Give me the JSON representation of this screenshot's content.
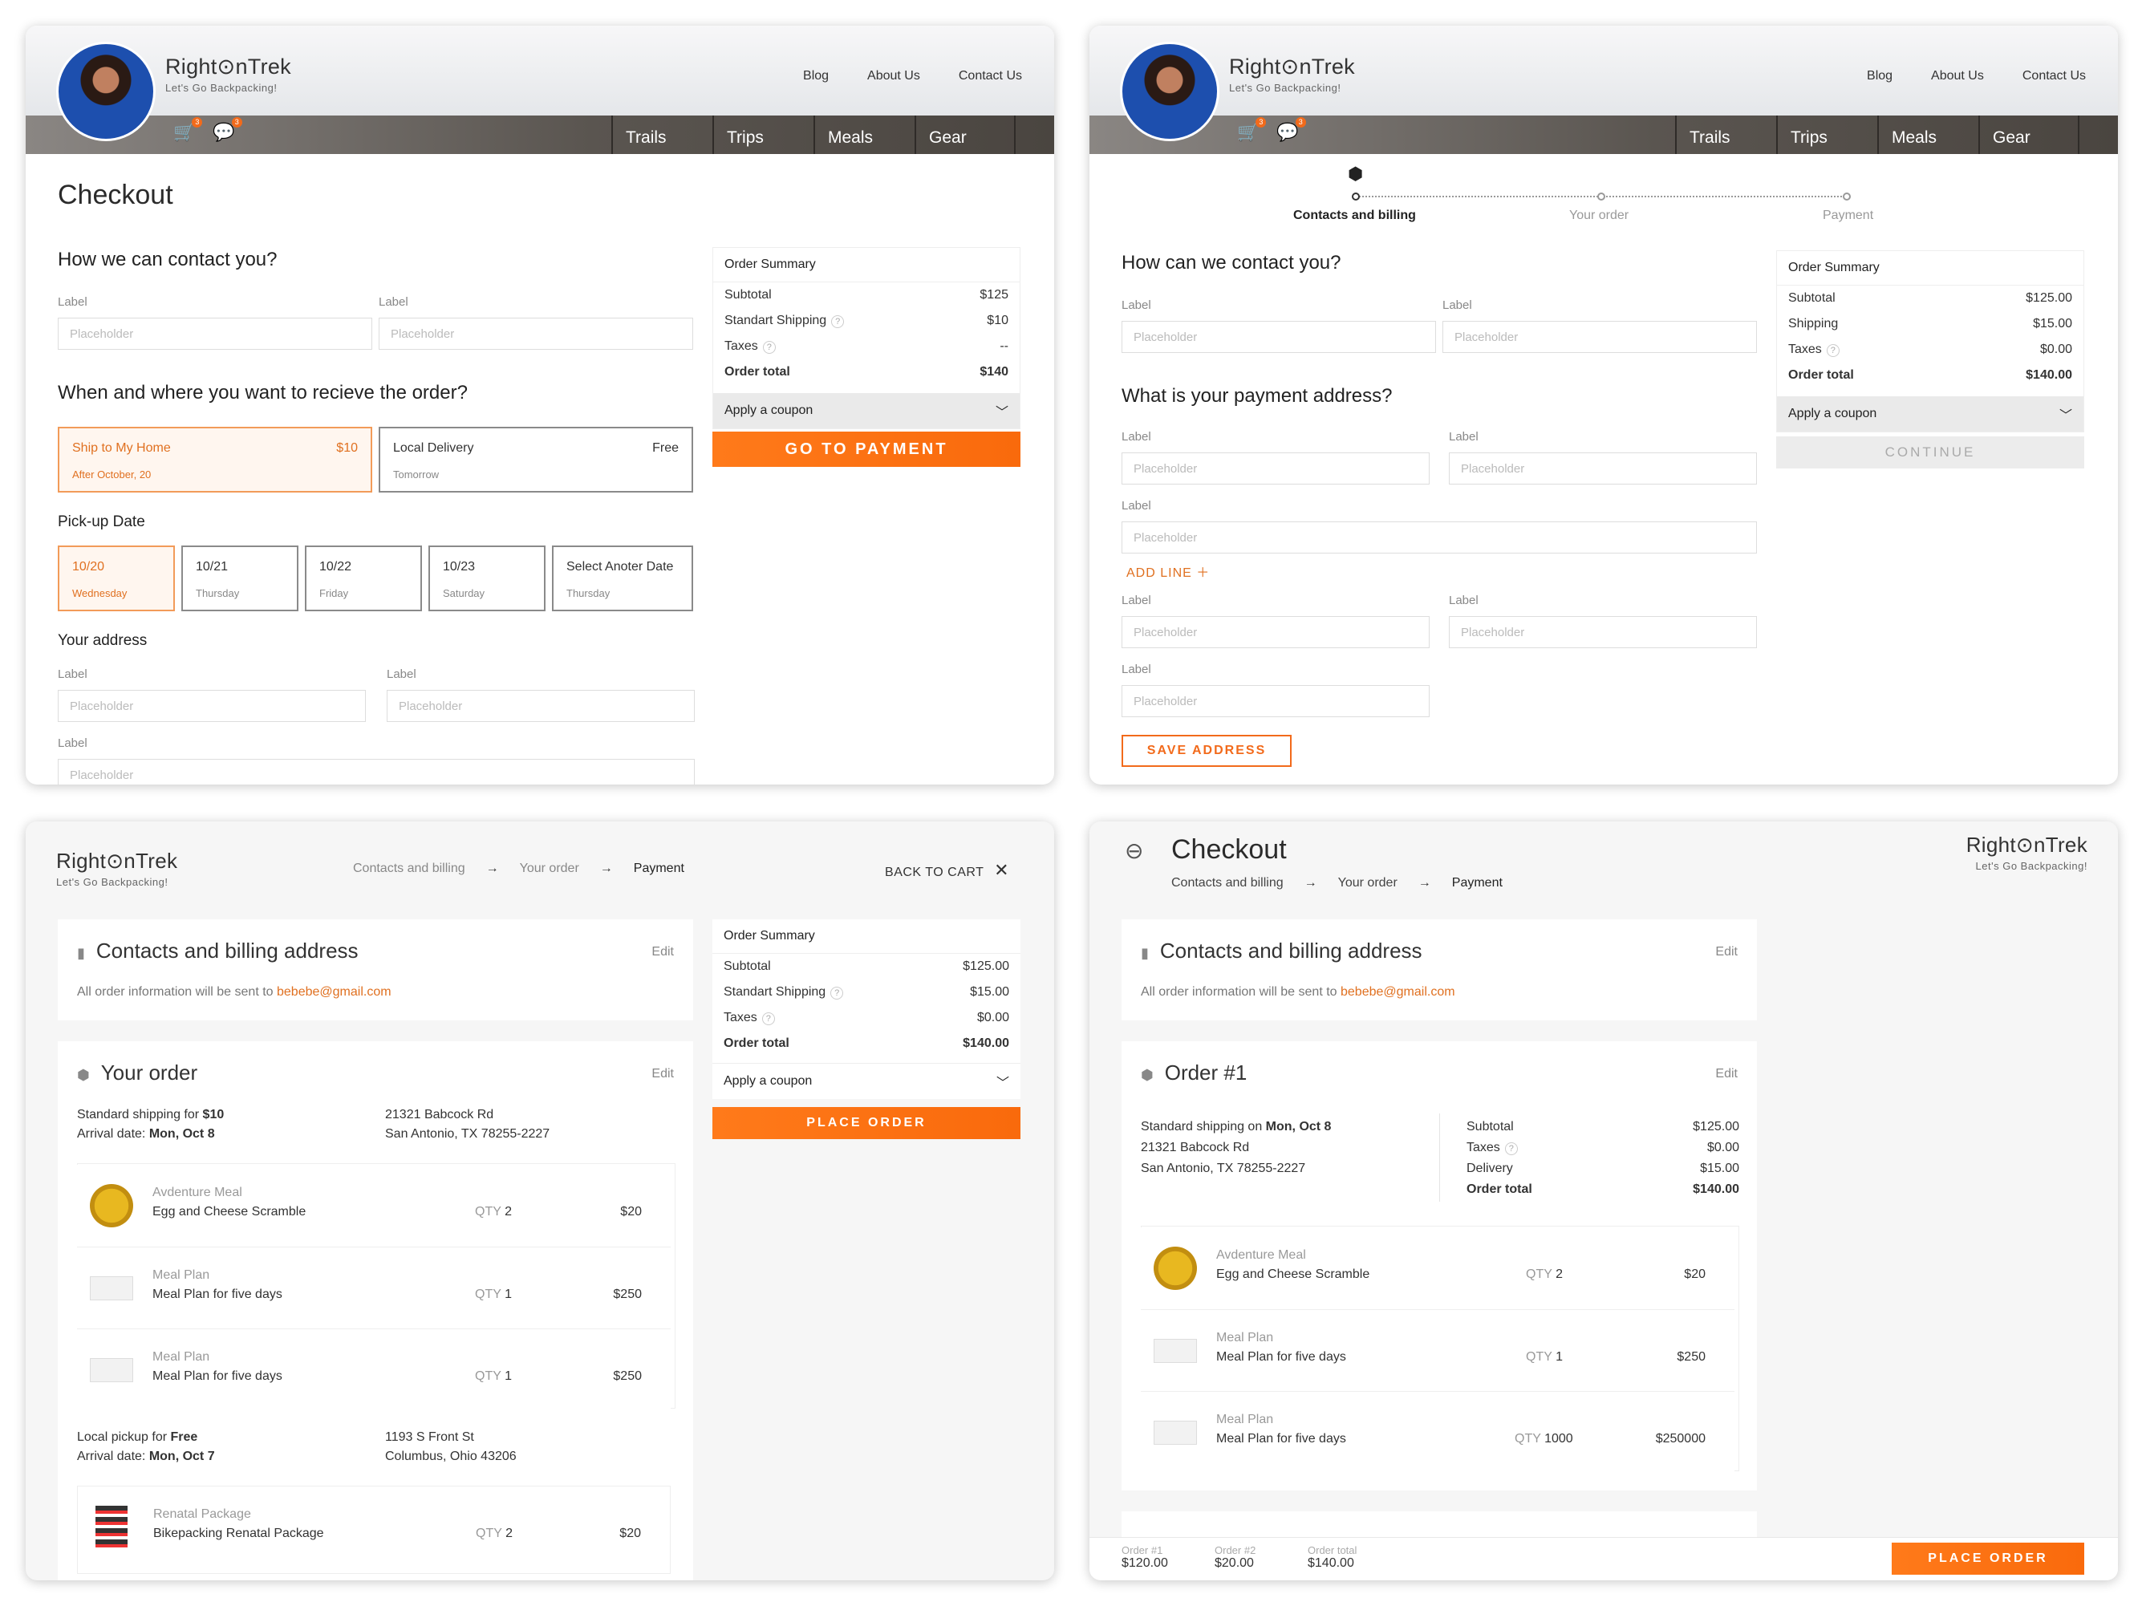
{
  "brand": {
    "name_a": "Right",
    "name_b": "nTrek",
    "tagline": "Let's Go Backpacking!"
  },
  "nav": {
    "links": [
      "Blog",
      "About Us",
      "Contact Us"
    ],
    "tabs": [
      "Trails",
      "Trips",
      "Meals",
      "Gear"
    ],
    "cart_count": "3",
    "msg_count": "3"
  },
  "s1": {
    "title": "Checkout",
    "contact_heading": "How we can contact you?",
    "label": "Label",
    "placeholder": "Placeholder",
    "delivery_heading": "When and where you want to recieve the order?",
    "ship_home": {
      "title": "Ship to My Home",
      "price": "$10",
      "sub": "After October, 20"
    },
    "local": {
      "title": "Local Delivery",
      "price": "Free",
      "sub": "Tomorrow"
    },
    "pickup_heading": "Pick-up Date",
    "dates": [
      {
        "d": "10/20",
        "w": "Wednesday"
      },
      {
        "d": "10/21",
        "w": "Thursday"
      },
      {
        "d": "10/22",
        "w": "Friday"
      },
      {
        "d": "10/23",
        "w": "Saturday"
      },
      {
        "d": "Select Anoter Date",
        "w": "Thursday"
      }
    ],
    "address_heading": "Your address",
    "summary": {
      "title": "Order Summary",
      "rows": [
        [
          "Subtotal",
          "$125"
        ],
        [
          "Standart Shipping",
          "$10"
        ],
        [
          "Taxes",
          "--"
        ],
        [
          "Order total",
          "$140"
        ]
      ],
      "coupon": "Apply a coupon",
      "button": "GO TO PAYMENT"
    }
  },
  "s2": {
    "steps": [
      "Contacts and billing",
      "Your order",
      "Payment"
    ],
    "contact_heading": "How can we contact you?",
    "payment_heading": "What is your payment address?",
    "add_line": "ADD LINE",
    "save": "SAVE ADDRESS",
    "summary": {
      "title": "Order Summary",
      "rows": [
        [
          "Subtotal",
          "$125.00"
        ],
        [
          "Shipping",
          "$15.00"
        ],
        [
          "Taxes",
          "$0.00"
        ],
        [
          "Order total",
          "$140.00"
        ]
      ],
      "coupon": "Apply a coupon",
      "button": "CONTINUE"
    }
  },
  "s3": {
    "steps": [
      "Contacts and billing",
      "Your order",
      "Payment"
    ],
    "back": "BACK TO CART",
    "contacts": {
      "title": "Contacts and billing address",
      "edit": "Edit",
      "info": "All order information will be sent to ",
      "email": "bebebe@gmail.com"
    },
    "order": {
      "title": "Your order",
      "edit": "Edit",
      "ship1a": "Standard shipping for ",
      "ship1b": "$10",
      "arr1a": "Arrival date: ",
      "arr1b": "Mon, Oct 8",
      "addr1a": "21321 Babcock Rd",
      "addr1b": "San Antonio, TX 78255-2227",
      "items": [
        {
          "c": "Avdenture Meal",
          "n": "Egg and Cheese Scramble",
          "q": "2",
          "p": "$20"
        },
        {
          "c": "Meal Plan",
          "n": "Meal Plan for five days",
          "q": "1",
          "p": "$250"
        },
        {
          "c": "Meal Plan",
          "n": "Meal Plan for five days",
          "q": "1",
          "p": "$250"
        }
      ],
      "ship2a": "Local pickup for ",
      "ship2b": "Free",
      "arr2a": "Arrival date: ",
      "arr2b": "Mon, Oct 7",
      "addr2a": "1193 S Front St",
      "addr2b": "Columbus, Ohio 43206",
      "item4": {
        "c": "Renatal Package",
        "n": "Bikepacking Renatal Package",
        "q": "2",
        "p": "$20"
      },
      "qty": "QTY"
    },
    "summary": {
      "title": "Order Summary",
      "rows": [
        [
          "Subtotal",
          "$125.00"
        ],
        [
          "Standart Shipping",
          "$15.00"
        ],
        [
          "Taxes",
          "$0.00"
        ],
        [
          "Order total",
          "$140.00"
        ]
      ],
      "coupon": "Apply a coupon",
      "button": "PLACE ORDER"
    }
  },
  "s4": {
    "title": "Checkout",
    "steps": [
      "Contacts and billing",
      "Your order",
      "Payment"
    ],
    "contacts": {
      "title": "Contacts and billing address",
      "edit": "Edit",
      "info": "All order information will be sent to ",
      "email": "bebebe@gmail.com"
    },
    "order": {
      "title": "Order #1",
      "edit": "Edit",
      "ship_a": "Standard shipping on ",
      "ship_b": "Mon, Oct 8",
      "addr_a": "21321 Babcock Rd",
      "addr_b": "San Antonio, TX 78255-2227",
      "totals": [
        [
          "Subtotal",
          "$125.00"
        ],
        [
          "Taxes",
          "$0.00"
        ],
        [
          "Delivery",
          "$15.00"
        ],
        [
          "Order total",
          "$140.00"
        ]
      ],
      "items": [
        {
          "c": "Avdenture Meal",
          "n": "Egg and Cheese Scramble",
          "q": "2",
          "p": "$20"
        },
        {
          "c": "Meal Plan",
          "n": "Meal Plan for five days",
          "q": "1",
          "p": "$250"
        },
        {
          "c": "Meal Plan",
          "n": "Meal Plan for five days",
          "q": "1000",
          "p": "$250000"
        }
      ]
    },
    "footer": [
      {
        "l": "Order #1",
        "v": "$120.00"
      },
      {
        "l": "Order #2",
        "v": "$20.00"
      },
      {
        "l": "Order total",
        "v": "$140.00"
      }
    ],
    "button": "PLACE ORDER"
  }
}
